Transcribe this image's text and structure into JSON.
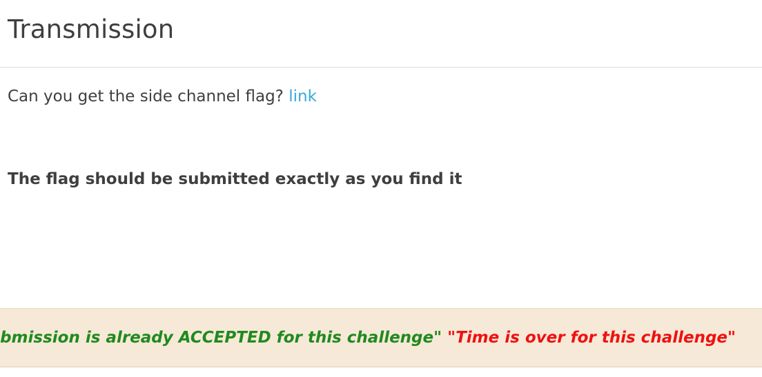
{
  "challenge": {
    "title": "Transmission",
    "question": "Can you get the side channel flag?",
    "link_label": "link",
    "note": "The flag should be submitted exactly as you find it"
  },
  "status": {
    "accepted_message": "\"Submission is already ACCEPTED for this challenge\"",
    "time_message": "\"Time is over for this challenge\"",
    "accepted_color": "#1f8a1f",
    "time_color": "#ee1111"
  },
  "colors": {
    "text": "#3f3f3f",
    "link": "#38a8dc",
    "footer_background": "#f7e9d7"
  }
}
